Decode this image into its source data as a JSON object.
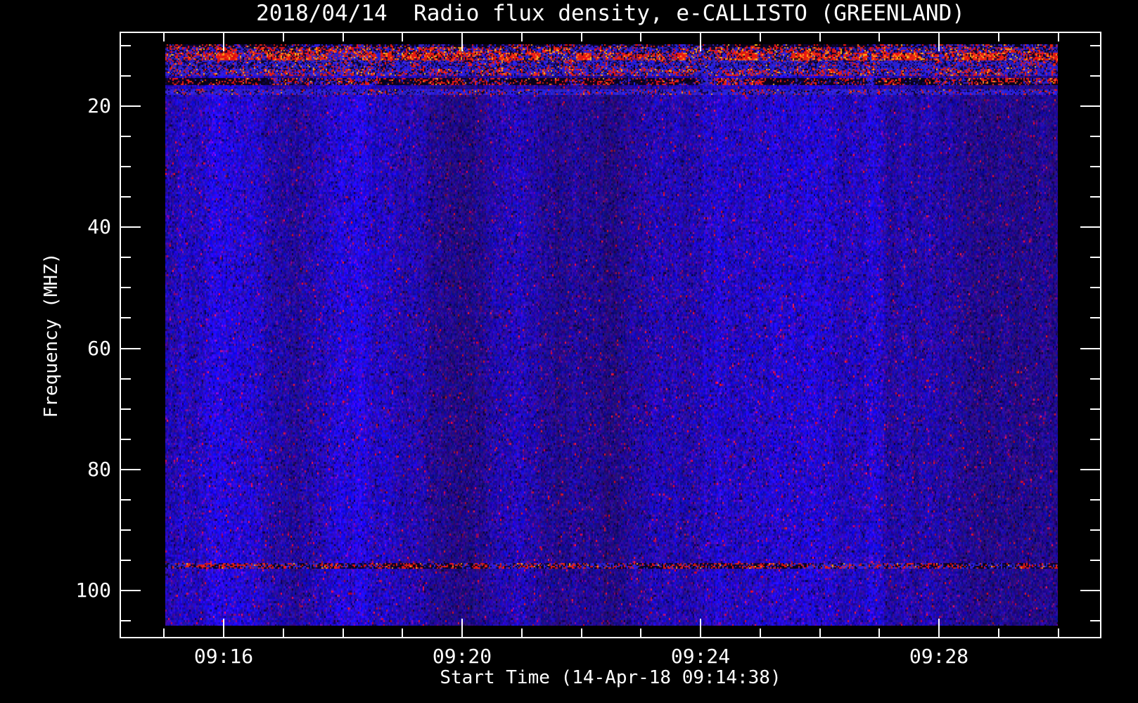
{
  "title": "2018/04/14  Radio flux density, e-CALLISTO (GREENLAND)",
  "chart_data": {
    "type": "heatmap",
    "title": "2018/04/14  Radio flux density, e-CALLISTO (GREENLAND)",
    "instrument": "e-CALLISTO (GREENLAND)",
    "date": "2018/04/14",
    "xlabel": "Start Time (14-Apr-18 09:14:38)",
    "ylabel": "Frequency (MHZ)",
    "x_axis": {
      "start_time": "09:14:38",
      "end_time": "09:30",
      "major_ticks": [
        {
          "minute": 16,
          "label": "09:16"
        },
        {
          "minute": 20,
          "label": "09:20"
        },
        {
          "minute": 24,
          "label": "09:24"
        },
        {
          "minute": 28,
          "label": "09:28"
        }
      ],
      "minor_tick_minutes": [
        15,
        17,
        18,
        19,
        21,
        22,
        23,
        25,
        26,
        27,
        29,
        30
      ]
    },
    "y_axis": {
      "unit": "MHz",
      "direction": "increasing-downward",
      "major_ticks": [
        20,
        40,
        60,
        80,
        100
      ],
      "minor_ticks": [
        10,
        15,
        25,
        30,
        35,
        45,
        50,
        55,
        65,
        70,
        75,
        85,
        90,
        95,
        105
      ],
      "data_range_mhz": [
        9.8,
        105.8
      ]
    },
    "colors": {
      "background": "#000000",
      "frame": "#ffffff",
      "text": "#ffffff",
      "body_blue": "#2222e0",
      "body_blue_bright": "#3535ff",
      "body_dark_blue": "#0d0d6e",
      "purple": "#5a1ea0",
      "red": "#e61400",
      "bright_orange": "#ff9614",
      "near_black": "#05051e"
    },
    "bands": [
      {
        "freq_mhz": [
          9.8,
          10.2
        ],
        "type": "edge_dark"
      },
      {
        "freq_mhz": [
          10.2,
          11.2
        ],
        "type": "speckle_red"
      },
      {
        "freq_mhz": [
          11.2,
          12.5
        ],
        "type": "strong_red"
      },
      {
        "freq_mhz": [
          12.5,
          13.9
        ],
        "type": "blue_red"
      },
      {
        "freq_mhz": [
          13.9,
          14.9
        ],
        "type": "red_streaks"
      },
      {
        "freq_mhz": [
          15.4,
          16.4
        ],
        "type": "dark_stripe"
      },
      {
        "freq_mhz": [
          17.2,
          18.1
        ],
        "type": "faint_red"
      },
      {
        "freq_mhz": [
          95.5,
          96.4
        ],
        "type": "fm_line"
      }
    ],
    "features": [
      {
        "name": "rfi-bands",
        "freq_mhz": [
          10,
          18
        ],
        "description": "Strong red/black broadcast interference bands across the top of the spectrogram"
      },
      {
        "name": "fm-interference-line",
        "freq_mhz": 96,
        "description": "Thin dashed red/black interference line near 96 MHz"
      },
      {
        "name": "quiet-background",
        "description": "Uniform blue noise background from ~10 to ~106 MHz, no solar burst visible"
      }
    ]
  }
}
